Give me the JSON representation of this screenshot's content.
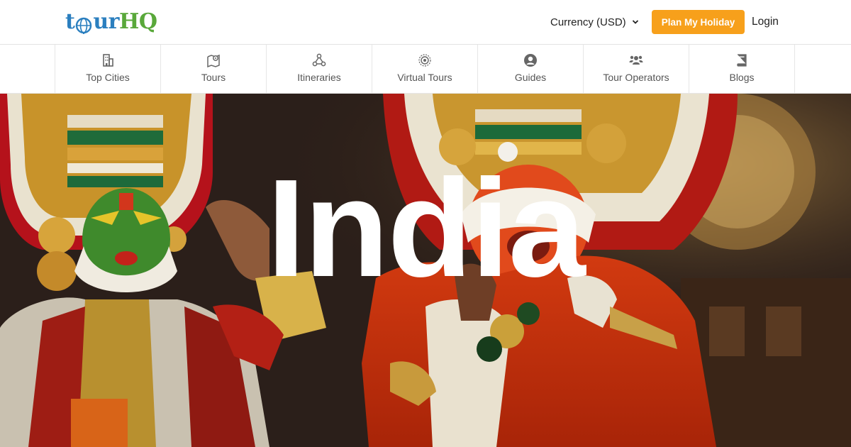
{
  "brand": {
    "logo_text": "tourHQ",
    "logo_parts": {
      "t": "t",
      "ur": "ur",
      "hq": "HQ"
    }
  },
  "header": {
    "currency_label": "Currency (USD)",
    "plan_button_label": "Plan My Holiday",
    "login_label": "Login"
  },
  "nav": {
    "items": [
      {
        "label": "Top Cities",
        "icon": "building-icon"
      },
      {
        "label": "Tours",
        "icon": "map-pin-icon"
      },
      {
        "label": "Itineraries",
        "icon": "sitemap-icon"
      },
      {
        "label": "Virtual Tours",
        "icon": "target-icon"
      },
      {
        "label": "Guides",
        "icon": "user-circle-icon"
      },
      {
        "label": "Tour Operators",
        "icon": "users-icon"
      },
      {
        "label": "Blogs",
        "icon": "book-icon"
      }
    ]
  },
  "hero": {
    "title": "India"
  },
  "colors": {
    "accent": "#f7a01b",
    "logo_blue": "#2b7fbf",
    "logo_green": "#59a83a"
  }
}
